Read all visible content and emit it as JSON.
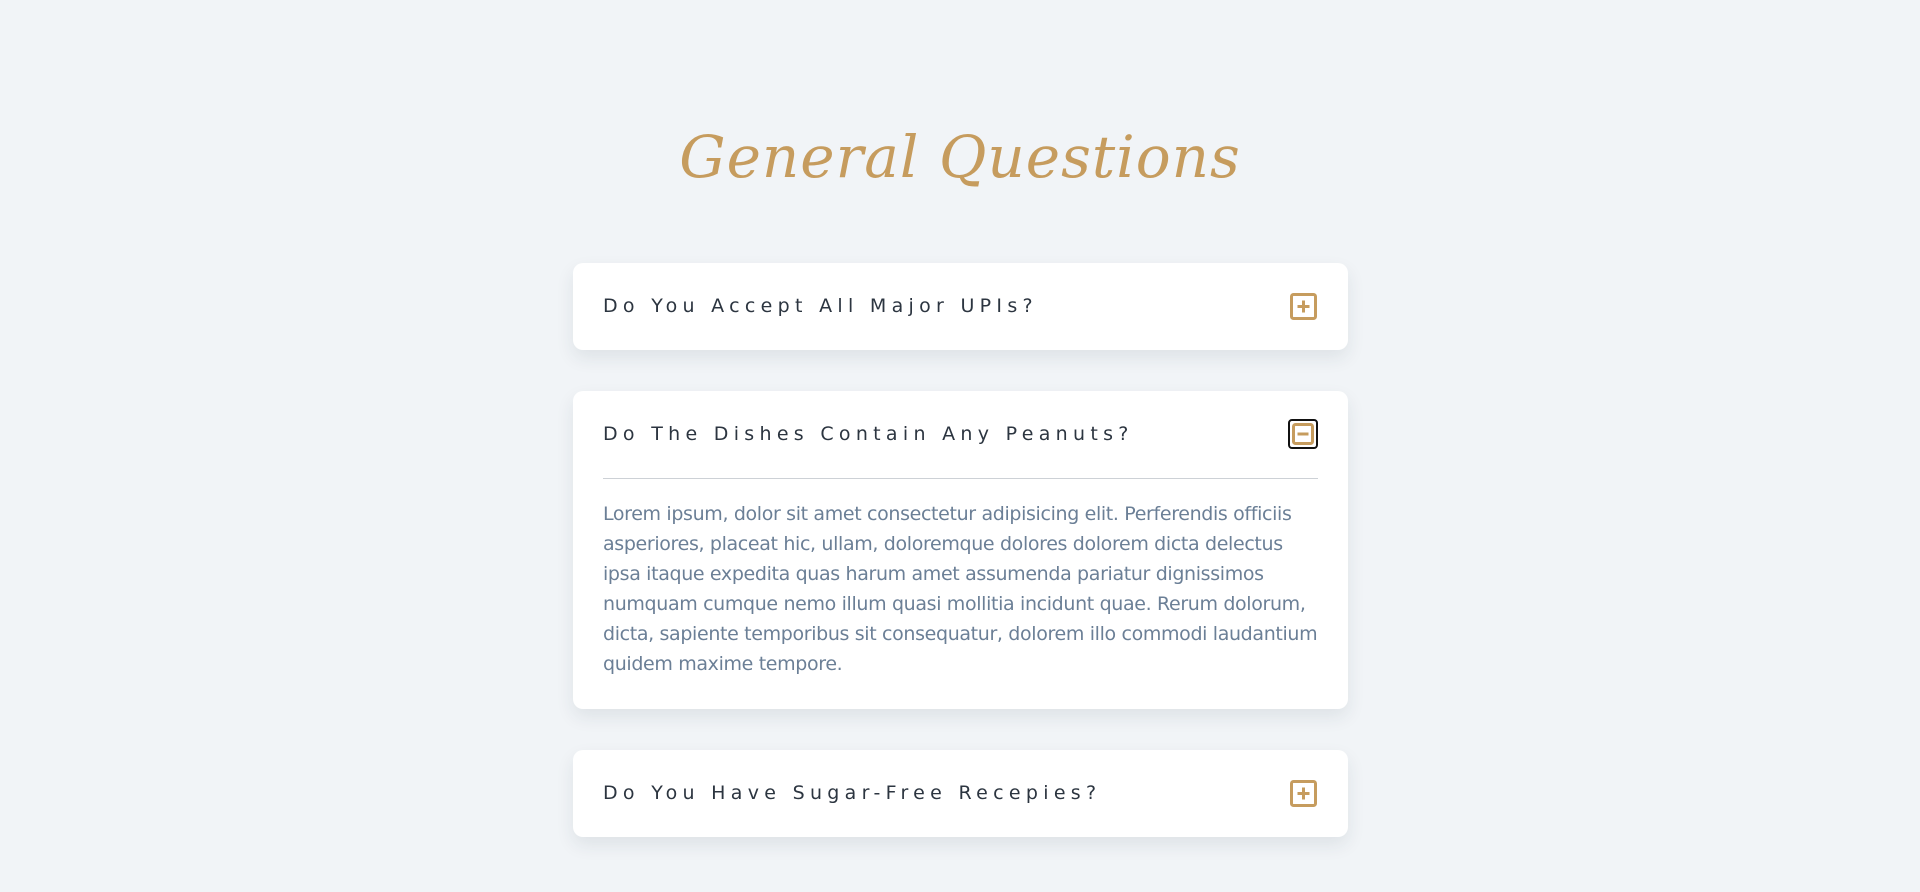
{
  "page": {
    "title": "General Questions"
  },
  "colors": {
    "accent": "#c69c5e",
    "background": "#f1f4f7",
    "card": "#ffffff",
    "question_text": "#2c3540",
    "answer_text": "#6b7f96"
  },
  "faq": {
    "items": [
      {
        "question": "Do You Accept All Major UPIs?",
        "expanded": false,
        "icon": "plus-square-icon"
      },
      {
        "question": "Do The Dishes Contain Any Peanuts?",
        "expanded": true,
        "icon": "minus-square-icon",
        "answer": "Lorem ipsum, dolor sit amet consectetur adipisicing elit. Perferendis officiis asperiores, placeat hic, ullam, doloremque dolores dolorem dicta delectus ipsa itaque expedita quas harum amet assumenda pariatur dignissimos numquam cumque nemo illum quasi mollitia incidunt quae. Rerum dolorum, dicta, sapiente temporibus sit consequatur, dolorem illo commodi laudantium quidem maxime tempore."
      },
      {
        "question": "Do You Have Sugar-Free Recepies?",
        "expanded": false,
        "icon": "plus-square-icon"
      }
    ]
  }
}
